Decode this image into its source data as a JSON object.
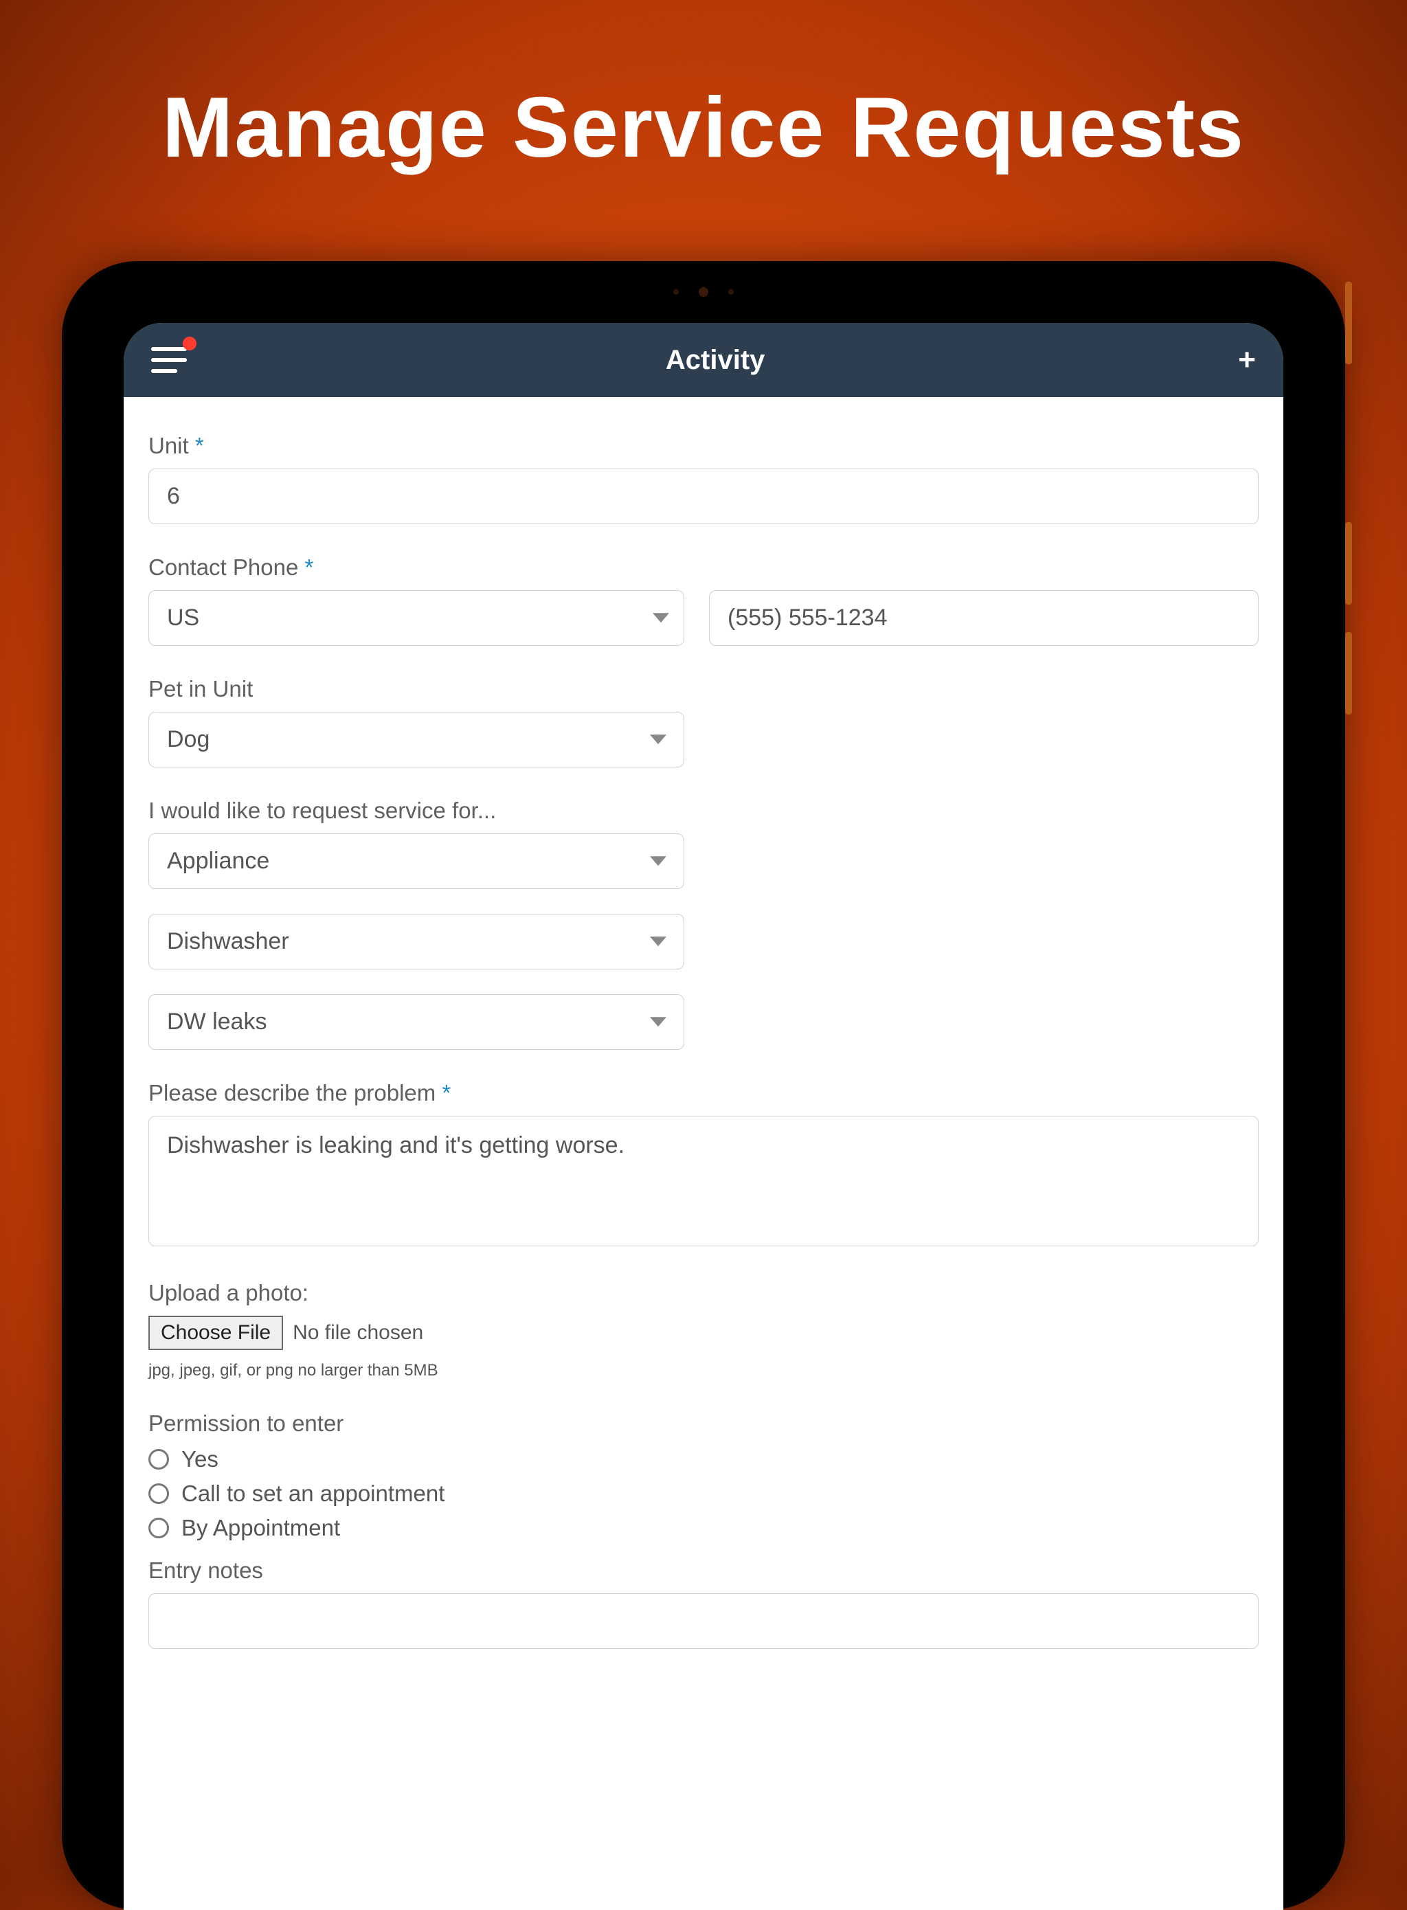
{
  "page": {
    "title": "Manage Service Requests"
  },
  "header": {
    "title": "Activity",
    "menu_has_notification": true,
    "add_label": "+"
  },
  "form": {
    "unit": {
      "label": "Unit",
      "required": true,
      "value": "6"
    },
    "phone": {
      "label": "Contact Phone",
      "required": true,
      "country": "US",
      "number": "(555) 555-1234"
    },
    "pet": {
      "label": "Pet in Unit",
      "value": "Dog"
    },
    "service": {
      "label": "I would like to request service for...",
      "category": "Appliance",
      "item": "Dishwasher",
      "issue": "DW leaks"
    },
    "problem": {
      "label": "Please describe the problem",
      "required": true,
      "value": "Dishwasher is leaking and it's getting worse."
    },
    "upload": {
      "label": "Upload a photo:",
      "button": "Choose File",
      "status": "No file chosen",
      "hint": "jpg, jpeg, gif, or png no larger than 5MB"
    },
    "permission": {
      "label": "Permission to enter",
      "options": [
        "Yes",
        "Call to set an appointment",
        "By Appointment"
      ]
    },
    "entry_notes": {
      "label": "Entry notes",
      "value": ""
    }
  }
}
